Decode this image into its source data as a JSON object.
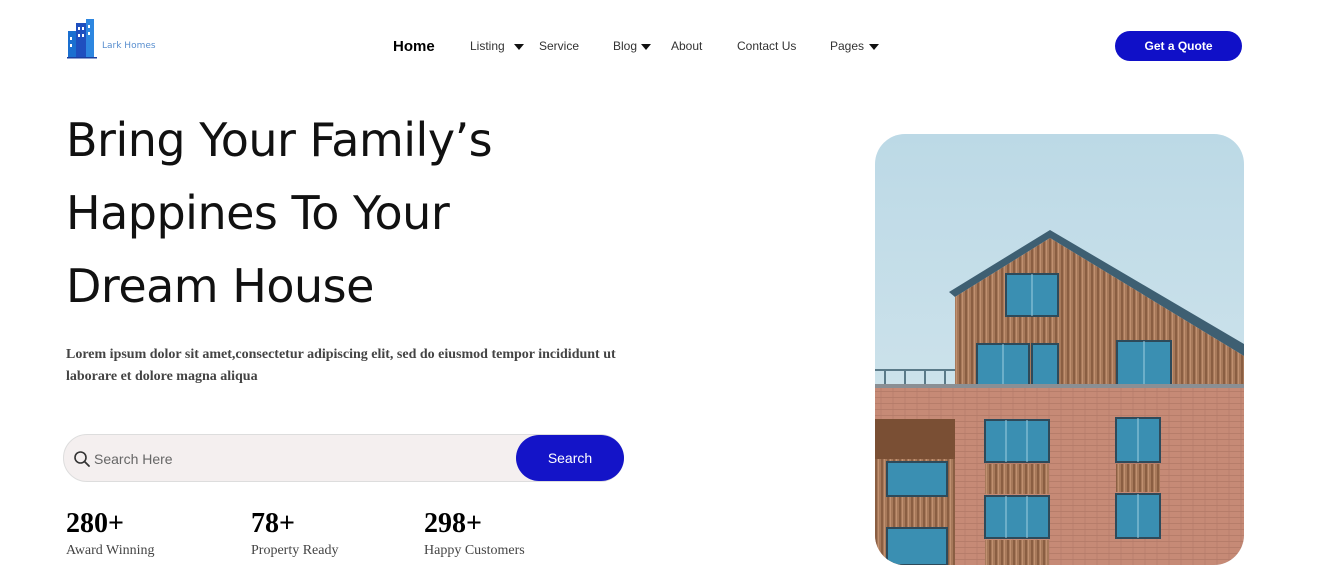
{
  "brand": {
    "name": "Lark Homes",
    "icon": "building-logo-icon"
  },
  "nav": {
    "items": [
      {
        "label": "Home",
        "active": true,
        "dropdown": false
      },
      {
        "label": "Listing",
        "active": false,
        "dropdown": true
      },
      {
        "label": "Service",
        "active": false,
        "dropdown": false
      },
      {
        "label": "Blog",
        "active": false,
        "dropdown": true
      },
      {
        "label": "About",
        "active": false,
        "dropdown": false
      },
      {
        "label": "Contact Us",
        "active": false,
        "dropdown": false
      },
      {
        "label": "Pages",
        "active": false,
        "dropdown": true
      }
    ],
    "cta_label": "Get a Quote"
  },
  "hero": {
    "title_lines": [
      "Bring Your Family’s",
      "Happines To Your",
      "Dream House"
    ],
    "description": "Lorem ipsum dolor sit amet,consectetur adipiscing elit, sed do eiusmod tempor incididunt ut laborare et dolore magna aliqua",
    "image_alt": "house-photo"
  },
  "search": {
    "placeholder": "Search Here",
    "value": "",
    "button_label": "Search",
    "icon": "search-icon"
  },
  "stats": [
    {
      "value": "280+",
      "label": "Award Winning"
    },
    {
      "value": "78+",
      "label": "Property Ready"
    },
    {
      "value": "298+",
      "label": "Happy Customers"
    }
  ],
  "colors": {
    "accent": "#1414c8",
    "search_bg": "#f4efef",
    "text": "#111111"
  }
}
